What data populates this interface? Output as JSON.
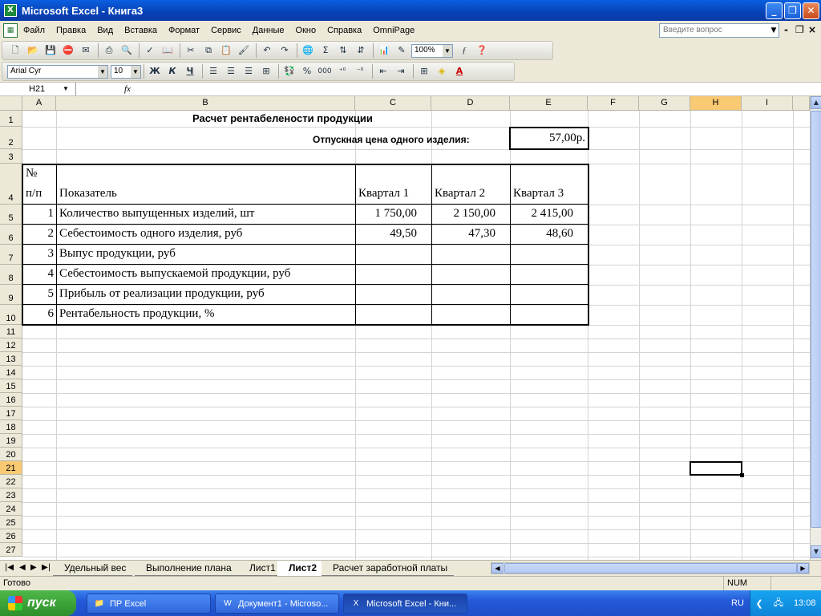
{
  "window": {
    "title": "Microsoft Excel - Книга3"
  },
  "menu": {
    "items": [
      "Файл",
      "Правка",
      "Вид",
      "Вставка",
      "Формат",
      "Сервис",
      "Данные",
      "Окно",
      "Справка",
      "OmniPage"
    ],
    "ask_placeholder": "Введите вопрос"
  },
  "toolbar": {
    "zoom": "100%",
    "font": "Arial Cyr",
    "size": "10",
    "bold": "Ж",
    "italic": "К",
    "underline": "Ч",
    "percent": "%",
    "thousands": "000"
  },
  "formula": {
    "cell_ref": "H21",
    "fx": "fx",
    "content": ""
  },
  "columns": [
    "A",
    "B",
    "C",
    "D",
    "E",
    "F",
    "G",
    "H",
    "I"
  ],
  "rows": [
    "1",
    "2",
    "3",
    "4",
    "5",
    "6",
    "7",
    "8",
    "9",
    "10",
    "11",
    "12",
    "13",
    "14",
    "15",
    "16",
    "17",
    "18",
    "19",
    "20",
    "21",
    "22",
    "23",
    "24",
    "25",
    "26",
    "27"
  ],
  "selected": {
    "col": "H",
    "row": "21"
  },
  "sheet": {
    "title": "Расчет рентабелености продукции",
    "price_label": "Отпускная цена одного изделия:",
    "price_value": "57,00р.",
    "hdr_num_1": "№",
    "hdr_num_2": "п/п",
    "hdr_indicator": "Показатель",
    "hdr_q1": "Квартал 1",
    "hdr_q2": "Квартал 2",
    "hdr_q3": "Квартал 3",
    "rows": [
      {
        "n": "1",
        "name": "Количество выпущенных изделий, шт",
        "q1": "1 750,00",
        "q2": "2 150,00",
        "q3": "2 415,00"
      },
      {
        "n": "2",
        "name": "Себестоимость одного изделия, руб",
        "q1": "49,50",
        "q2": "47,30",
        "q3": "48,60"
      },
      {
        "n": "3",
        "name": "Выпус продукции, руб",
        "q1": "",
        "q2": "",
        "q3": ""
      },
      {
        "n": "4",
        "name": "Себестоимость выпускаемой продукции, руб",
        "q1": "",
        "q2": "",
        "q3": ""
      },
      {
        "n": "5",
        "name": "Прибыль от реализации продукции, руб",
        "q1": "",
        "q2": "",
        "q3": ""
      },
      {
        "n": "6",
        "name": "Рентабельность продукции, %",
        "q1": "",
        "q2": "",
        "q3": ""
      }
    ]
  },
  "tabs": [
    "Удельный вес",
    "Выполнение плана",
    "Лист1",
    "Лист2",
    "Расчет заработной платы"
  ],
  "active_tab": "Лист2",
  "status": {
    "ready": "Готово",
    "num": "NUM"
  },
  "taskbar": {
    "start": "пуск",
    "tasks": [
      "ПР Excel",
      "Документ1 - Microso...",
      "Microsoft Excel - Кни..."
    ],
    "lang": "RU",
    "clock": "13:08"
  }
}
